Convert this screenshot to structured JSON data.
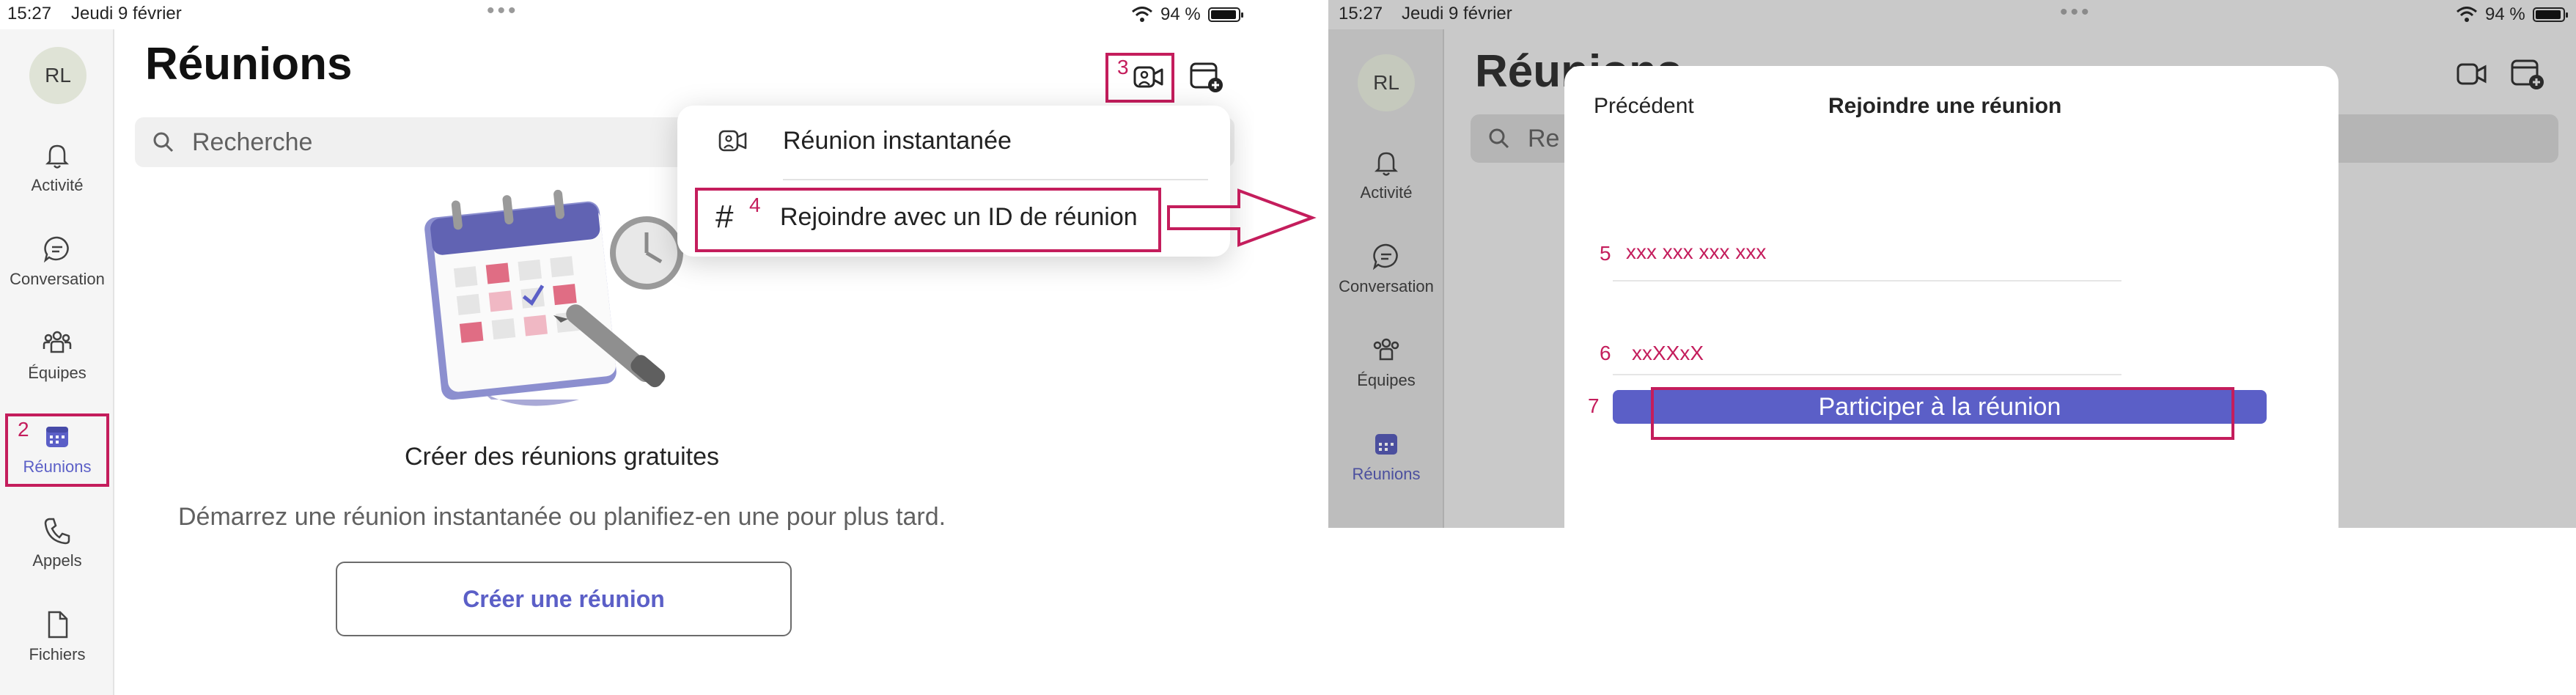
{
  "status": {
    "time": "15:27",
    "date": "Jeudi 9 février",
    "battery": "94 %",
    "battery_level": 0.94
  },
  "profile": {
    "initials": "RL"
  },
  "sidebar": {
    "items": [
      {
        "label": "Activité",
        "icon": "bell-icon"
      },
      {
        "label": "Conversation",
        "icon": "chat-icon"
      },
      {
        "label": "Équipes",
        "icon": "teams-icon"
      },
      {
        "label": "Réunions",
        "icon": "calendar-icon",
        "active": true
      },
      {
        "label": "Appels",
        "icon": "phone-icon"
      },
      {
        "label": "Fichiers",
        "icon": "file-icon"
      }
    ]
  },
  "page": {
    "title": "Réunions",
    "search_placeholder": "Recherche",
    "search_placeholder_truncated": "Re"
  },
  "menu": {
    "items": [
      {
        "label": "Réunion instantanée",
        "icon": "video-camera-icon"
      },
      {
        "label": "Rejoindre avec un ID de réunion",
        "icon": "hash-icon"
      }
    ]
  },
  "empty_state": {
    "title": "Créer des réunions gratuites",
    "subtitle": "Démarrez une réunion instantanée ou planifiez-en une pour plus tard.",
    "button": "Créer une réunion",
    "illustration": "calendar-clock-pen-illustration"
  },
  "annotations": {
    "step2": "2",
    "step3": "3",
    "step4": "4",
    "step5": "5",
    "step6": "6",
    "step7": "7"
  },
  "join_dialog": {
    "back_label": "Précédent",
    "title": "Rejoindre une réunion",
    "meeting_id_value": "xxx xxx xxx xxx",
    "passcode_value": "xxXXxX",
    "join_button": "Participer à la réunion",
    "title_behind": "Réunions"
  },
  "colors": {
    "accent": "#5b5fc7",
    "annotation": "#c41d5c",
    "rail_bg": "#f5f5f5"
  }
}
